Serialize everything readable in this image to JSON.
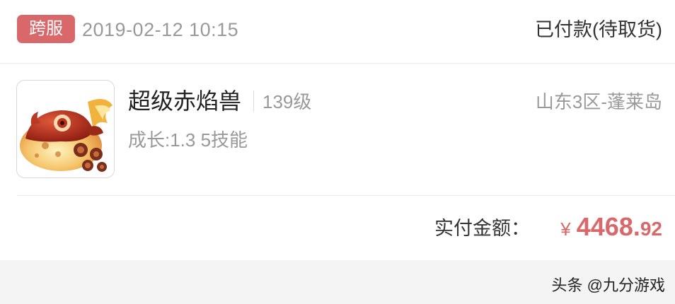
{
  "order": {
    "badge": "跨服",
    "time": "2019-02-12 10:15",
    "status": "已付款(待取货)"
  },
  "item": {
    "image_icon": "pet-fire-beast-image",
    "name": "超级赤焰兽",
    "level": "139级",
    "server": "山东3区-蓬莱岛",
    "attributes": "成长:1.3 5技能"
  },
  "payment": {
    "label": "实付金额：",
    "currency": "¥",
    "amount_integer": "4468.",
    "amount_decimal": "92"
  },
  "watermark": "头条 @九分游戏",
  "colors": {
    "accent": "#d9686a",
    "muted_text": "#999999",
    "footer_bg": "#f4f4f4"
  }
}
